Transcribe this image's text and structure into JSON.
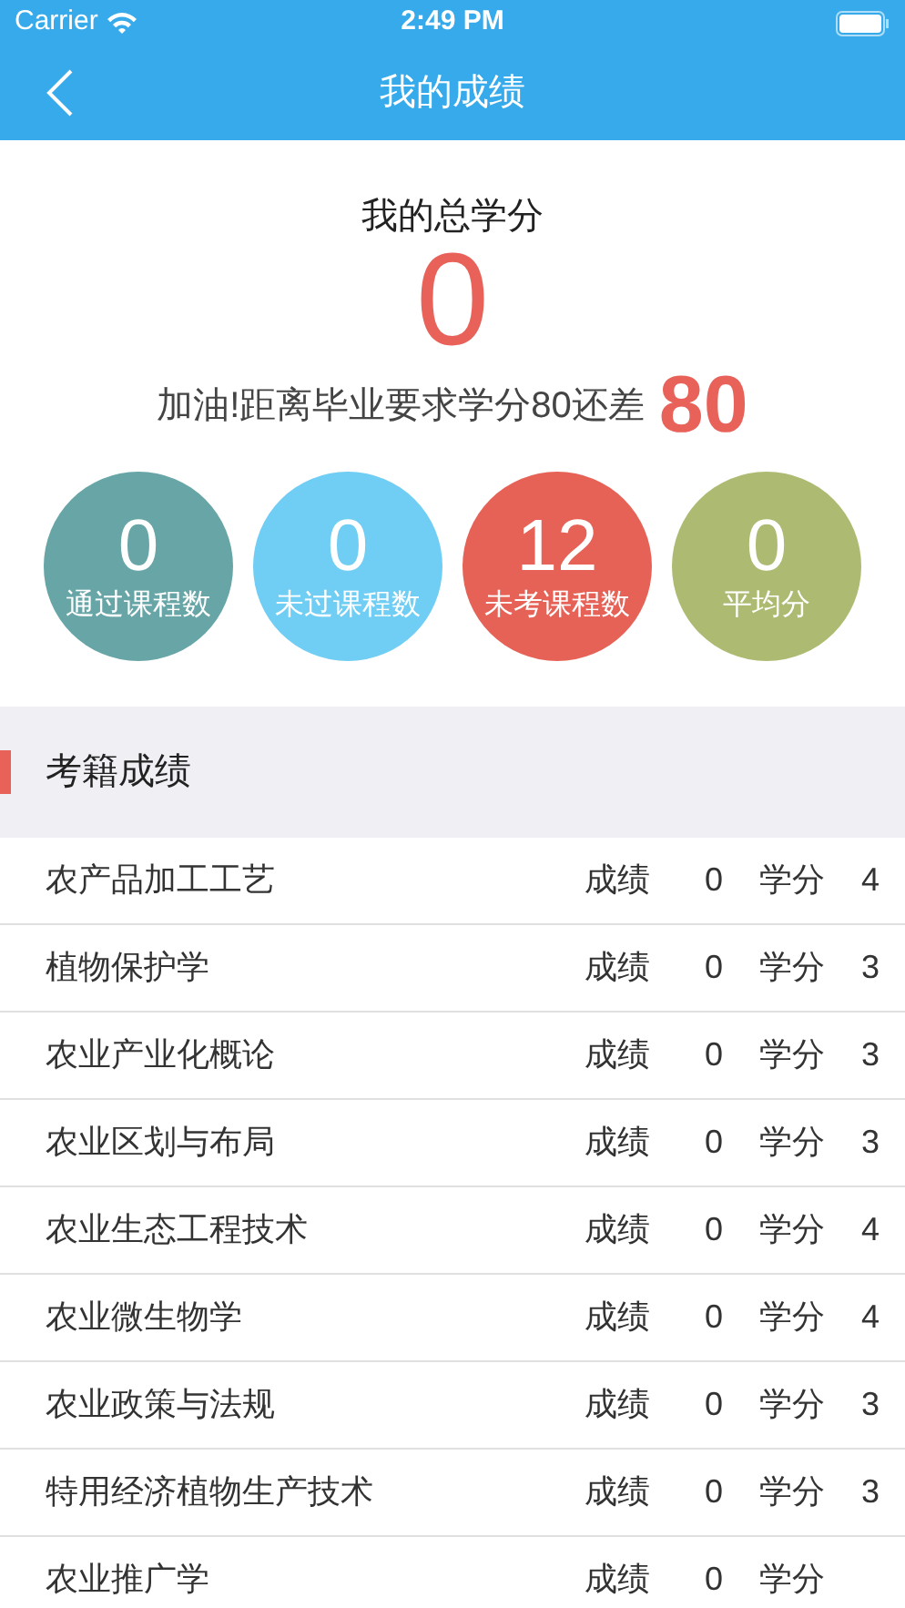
{
  "status_bar": {
    "carrier": "Carrier",
    "time": "2:49 PM"
  },
  "nav": {
    "title": "我的成绩"
  },
  "summary": {
    "label": "我的总学分",
    "total": "0",
    "remaining_text": "加油!距离毕业要求学分80还差",
    "remaining": "80"
  },
  "stats": [
    {
      "value": "0",
      "label": "通过课程数",
      "color": "#67a5a7"
    },
    {
      "value": "0",
      "label": "未过课程数",
      "color": "#70cdf3"
    },
    {
      "value": "12",
      "label": "未考课程数",
      "color": "#e66257"
    },
    {
      "value": "0",
      "label": "平均分",
      "color": "#adba72"
    }
  ],
  "section": {
    "title": "考籍成绩"
  },
  "rows": [
    {
      "name": "农产品加工工艺",
      "score_label": "成绩",
      "score": "0",
      "credit_label": "学分",
      "credit": "4"
    },
    {
      "name": "植物保护学",
      "score_label": "成绩",
      "score": "0",
      "credit_label": "学分",
      "credit": "3"
    },
    {
      "name": "农业产业化概论",
      "score_label": "成绩",
      "score": "0",
      "credit_label": "学分",
      "credit": "3"
    },
    {
      "name": "农业区划与布局",
      "score_label": "成绩",
      "score": "0",
      "credit_label": "学分",
      "credit": "3"
    },
    {
      "name": "农业生态工程技术",
      "score_label": "成绩",
      "score": "0",
      "credit_label": "学分",
      "credit": "4"
    },
    {
      "name": "农业微生物学",
      "score_label": "成绩",
      "score": "0",
      "credit_label": "学分",
      "credit": "4"
    },
    {
      "name": "农业政策与法规",
      "score_label": "成绩",
      "score": "0",
      "credit_label": "学分",
      "credit": "3"
    },
    {
      "name": "特用经济植物生产技术",
      "score_label": "成绩",
      "score": "0",
      "credit_label": "学分",
      "credit": "3"
    },
    {
      "name": "农业推广学",
      "score_label": "成绩",
      "score": "0",
      "credit_label": "学分"
    }
  ]
}
